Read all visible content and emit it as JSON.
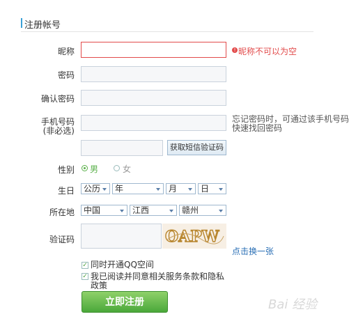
{
  "section": {
    "title": "注册帐号"
  },
  "form": {
    "nickname": {
      "label": "昵称",
      "value": "",
      "error": "昵称不可以为空",
      "error_icon": "!"
    },
    "password": {
      "label": "密码",
      "value": ""
    },
    "confirm": {
      "label": "确认密码",
      "value": ""
    },
    "phone": {
      "label_line1": "手机号码",
      "label_line2": "(非必选)",
      "value": "",
      "hint": "忘记密码时，可通过该手机号码快速找回密码"
    },
    "sms": {
      "value": "",
      "button_label": "获取短信验证码"
    },
    "gender": {
      "label": "性别",
      "options": [
        "男",
        "女"
      ],
      "selected": "男"
    },
    "birthday": {
      "label": "生日",
      "calendar": "公历",
      "year": "年",
      "month": "月",
      "day": "日"
    },
    "location": {
      "label": "所在地",
      "country": "中国",
      "province": "江西",
      "city": "赣州"
    },
    "captcha": {
      "label": "验证码",
      "value": "",
      "image_text": "OAPW",
      "refresh_link": "点击换一张"
    },
    "opt_qzone": {
      "checked": true,
      "label": "同时开通QQ空间"
    },
    "opt_terms": {
      "checked": true,
      "label": "我已阅读并同意相关服务条款和隐私政策",
      "check_mark": "✓"
    },
    "submit_label": "立即注册"
  },
  "watermark": "Bai 经验"
}
